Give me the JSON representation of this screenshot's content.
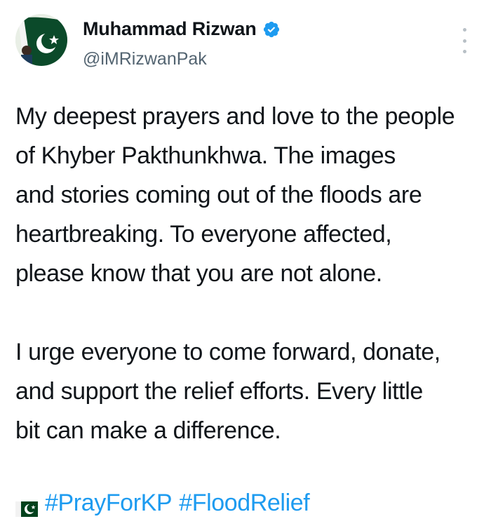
{
  "user": {
    "display_name": "Muhammad Rizwan",
    "handle": "@iMRizwanPak",
    "verified": true,
    "verified_color": "#1d9bf0",
    "avatar_icon": "pakistan-flag-profile-avatar"
  },
  "menu": {
    "icon": "more-vertical-icon"
  },
  "tweet": {
    "paragraph1_lines": [
      "My deepest prayers and love to the people",
      "of Khyber Pakthunkhwa. The images",
      "and stories coming out of the floods are",
      "heartbreaking. To everyone affected,",
      "please know that you are not alone."
    ],
    "paragraph2_lines": [
      "I urge everyone to come forward, donate,",
      "and support the relief efforts. Every little",
      "bit can make a difference."
    ],
    "flag_emoji": "pakistan-flag-icon",
    "hashtags": [
      "#PrayForKP",
      "#FloodRelief"
    ]
  },
  "colors": {
    "text": "#0f1419",
    "secondary_text": "#536471",
    "link": "#1d9bf0",
    "flag_green": "#01411c"
  }
}
